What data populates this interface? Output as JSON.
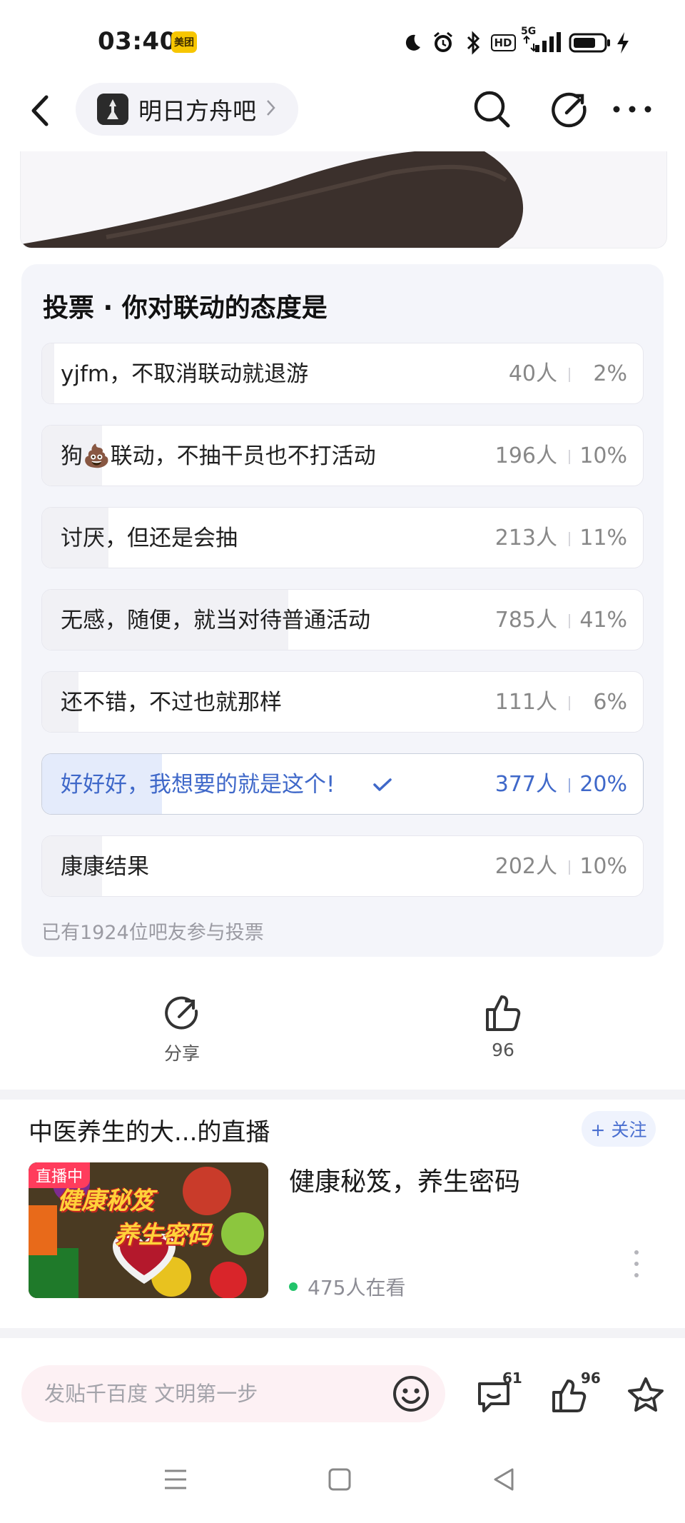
{
  "status_bar": {
    "time": "03:40",
    "app_badge": "美团",
    "network_label": "5G",
    "hd_label": "HD"
  },
  "nav": {
    "forum_name": "明日方舟吧"
  },
  "poll": {
    "title": "投票 · 你对联动的态度是",
    "options": [
      {
        "label": "yjfm，不取消联动就退游",
        "count": "40人",
        "percent": "2%",
        "fraction": 0.02,
        "selected": false
      },
      {
        "label": "狗💩联动，不抽干员也不打活动",
        "count": "196人",
        "percent": "10%",
        "fraction": 0.1,
        "selected": false
      },
      {
        "label": "讨厌，但还是会抽",
        "count": "213人",
        "percent": "11%",
        "fraction": 0.11,
        "selected": false
      },
      {
        "label": "无感，随便，就当对待普通活动",
        "count": "785人",
        "percent": "41%",
        "fraction": 0.41,
        "selected": false
      },
      {
        "label": "还不错，不过也就那样",
        "count": "111人",
        "percent": "6%",
        "fraction": 0.06,
        "selected": false
      },
      {
        "label": "好好好，我想要的就是这个!",
        "count": "377人",
        "percent": "20%",
        "fraction": 0.2,
        "selected": true
      },
      {
        "label": "康康结果",
        "count": "202人",
        "percent": "10%",
        "fraction": 0.1,
        "selected": false
      }
    ],
    "footer": "已有1924位吧友参与投票"
  },
  "actions": {
    "share_label": "分享",
    "like_count": "96"
  },
  "live": {
    "streamer_title": "中医养生的大...的直播",
    "follow_label": "+ 关注",
    "badge": "直播中",
    "thumb_line1": "健康秘笈",
    "thumb_line2": "养生密码",
    "headline": "健康秘笈，养生密码",
    "viewers": "475人在看"
  },
  "bottom_bar": {
    "input_placeholder": "发贴千百度 文明第一步",
    "comment_count": "61",
    "like_count": "96"
  },
  "colors": {
    "accent": "#3f68c9",
    "live_red": "#ff3c5c",
    "online_green": "#22c36a"
  }
}
